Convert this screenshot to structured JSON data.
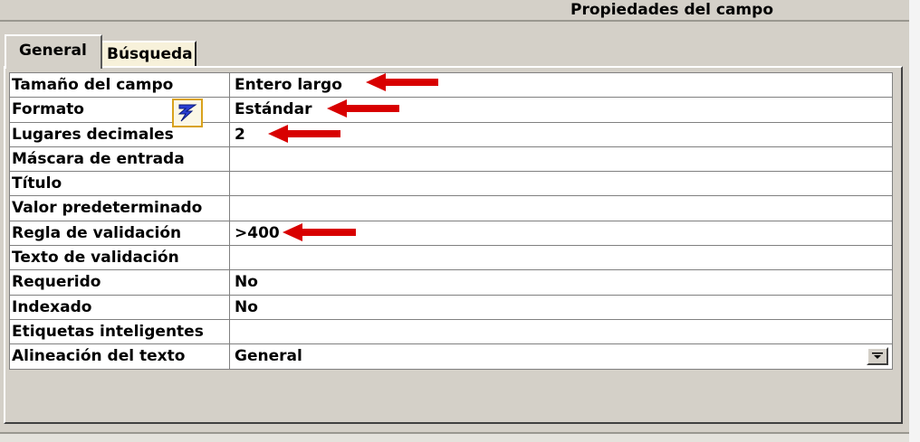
{
  "window": {
    "title": "Propiedades del campo"
  },
  "tabs": [
    {
      "label": "General",
      "active": true
    },
    {
      "label": "Búsqueda",
      "active": false
    }
  ],
  "properties": [
    {
      "name": "Tamaño del campo",
      "value": "Entero largo"
    },
    {
      "name": "Formato",
      "value": "Estándar"
    },
    {
      "name": "Lugares decimales",
      "value": "2"
    },
    {
      "name": "Máscara de entrada",
      "value": ""
    },
    {
      "name": "Título",
      "value": ""
    },
    {
      "name": "Valor predeterminado",
      "value": ""
    },
    {
      "name": "Regla de validación",
      "value": ">400"
    },
    {
      "name": "Texto de validación",
      "value": ""
    },
    {
      "name": "Requerido",
      "value": "No"
    },
    {
      "name": "Indexado",
      "value": "No"
    },
    {
      "name": "Etiquetas inteligentes",
      "value": ""
    },
    {
      "name": "Alineación del texto",
      "value": "General"
    }
  ],
  "icons": {
    "builder": "builder-lightning-icon",
    "dropdown": "chevron-down-icon",
    "annotation": "red-arrow-icon"
  },
  "colors": {
    "annotation_arrow": "#d80000",
    "builder_border": "#d9a21c",
    "tab_busqueda_bg": "#f7f1da"
  }
}
